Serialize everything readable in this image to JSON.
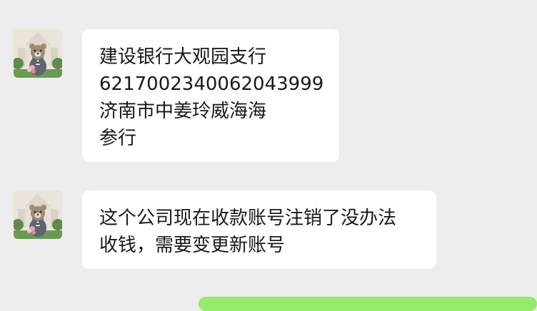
{
  "messages": [
    {
      "sender": "incoming",
      "avatar_icon": "teddy-bear-groom-avatar-icon",
      "lines": [
        "建设银行大观园支行",
        "6217002340062043999",
        "济南市中姜玲威海海",
        "参行"
      ]
    },
    {
      "sender": "incoming",
      "avatar_icon": "teddy-bear-groom-avatar-icon",
      "lines": [
        "这个公司现在收款账号注销了没办法",
        "收钱，需要变更新账号"
      ]
    }
  ],
  "colors": {
    "background": "#ededed",
    "incoming_bubble": "#ffffff",
    "outgoing_bubble": "#95ec69",
    "text": "#191919"
  }
}
